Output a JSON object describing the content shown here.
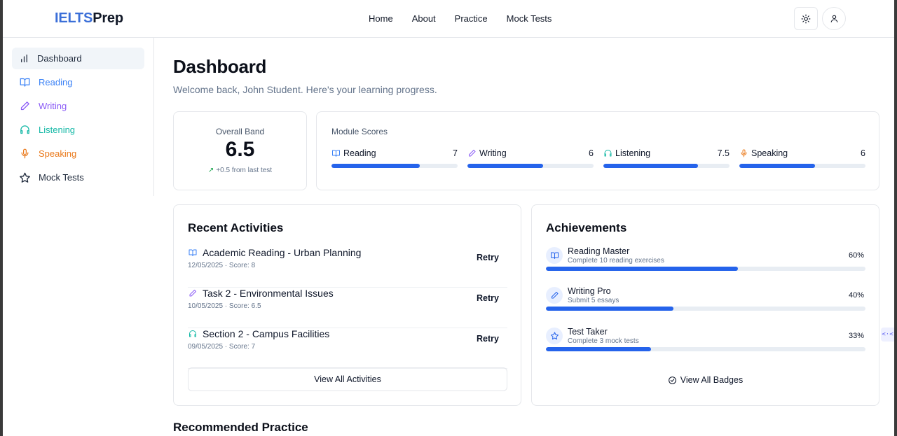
{
  "brand": {
    "part1": "IELTS",
    "part2": "Prep"
  },
  "nav": [
    "Home",
    "About",
    "Practice",
    "Mock Tests"
  ],
  "header_icons": [
    "sun-icon",
    "user-icon"
  ],
  "sidebar": [
    {
      "label": "Dashboard",
      "icon": "bar-chart-icon",
      "color": "#1e293b",
      "active": true
    },
    {
      "label": "Reading",
      "icon": "book-open-icon",
      "color": "#3b82f6"
    },
    {
      "label": "Writing",
      "icon": "pen-icon",
      "color": "#8b5cf6"
    },
    {
      "label": "Listening",
      "icon": "headphones-icon",
      "color": "#14b8a6"
    },
    {
      "label": "Speaking",
      "icon": "mic-icon",
      "color": "#ea7a1c"
    },
    {
      "label": "Mock Tests",
      "icon": "star-icon",
      "color": "#1e293b"
    }
  ],
  "page": {
    "title": "Dashboard",
    "subtitle": "Welcome back, John Student. Here's your learning progress."
  },
  "overall": {
    "label": "Overall Band",
    "value": "6.5",
    "delta": "+0.5 from last test"
  },
  "modules": {
    "label": "Module Scores",
    "items": [
      {
        "name": "Reading",
        "score": "7",
        "fill": 0.7,
        "icon": "book-open-icon",
        "color": "#3b82f6"
      },
      {
        "name": "Writing",
        "score": "6",
        "fill": 0.6,
        "icon": "pen-icon",
        "color": "#8b5cf6"
      },
      {
        "name": "Listening",
        "score": "7.5",
        "fill": 0.75,
        "icon": "headphones-icon",
        "color": "#14b8a6"
      },
      {
        "name": "Speaking",
        "score": "6",
        "fill": 0.6,
        "icon": "mic-icon",
        "color": "#ea7a1c"
      }
    ]
  },
  "recent": {
    "title": "Recent Activities",
    "items": [
      {
        "title": "Academic Reading - Urban Planning",
        "meta": "12/05/2025 · Score: 8",
        "action": "Retry",
        "icon": "book-open-icon"
      },
      {
        "title": "Task 2 - Environmental Issues",
        "meta": "10/05/2025 · Score: 6.5",
        "action": "Retry",
        "icon": "pen-icon"
      },
      {
        "title": "Section 2 - Campus Facilities",
        "meta": "09/05/2025 · Score: 7",
        "action": "Retry",
        "icon": "headphones-icon"
      }
    ],
    "view_all": "View All Activities"
  },
  "achievements": {
    "title": "Achievements",
    "items": [
      {
        "name": "Reading Master",
        "desc": "Complete 10 reading exercises",
        "percent": "60%",
        "fill": 0.6,
        "icon": "book-open-icon"
      },
      {
        "name": "Writing Pro",
        "desc": "Submit 5 essays",
        "percent": "40%",
        "fill": 0.4,
        "icon": "pen-icon"
      },
      {
        "name": "Test Taker",
        "desc": "Complete 3 mock tests",
        "percent": "33%",
        "fill": 0.33,
        "icon": "star-icon"
      }
    ],
    "view_all": "View All Badges"
  },
  "recommended": {
    "title": "Recommended Practice"
  },
  "floating_widget": "<·<"
}
